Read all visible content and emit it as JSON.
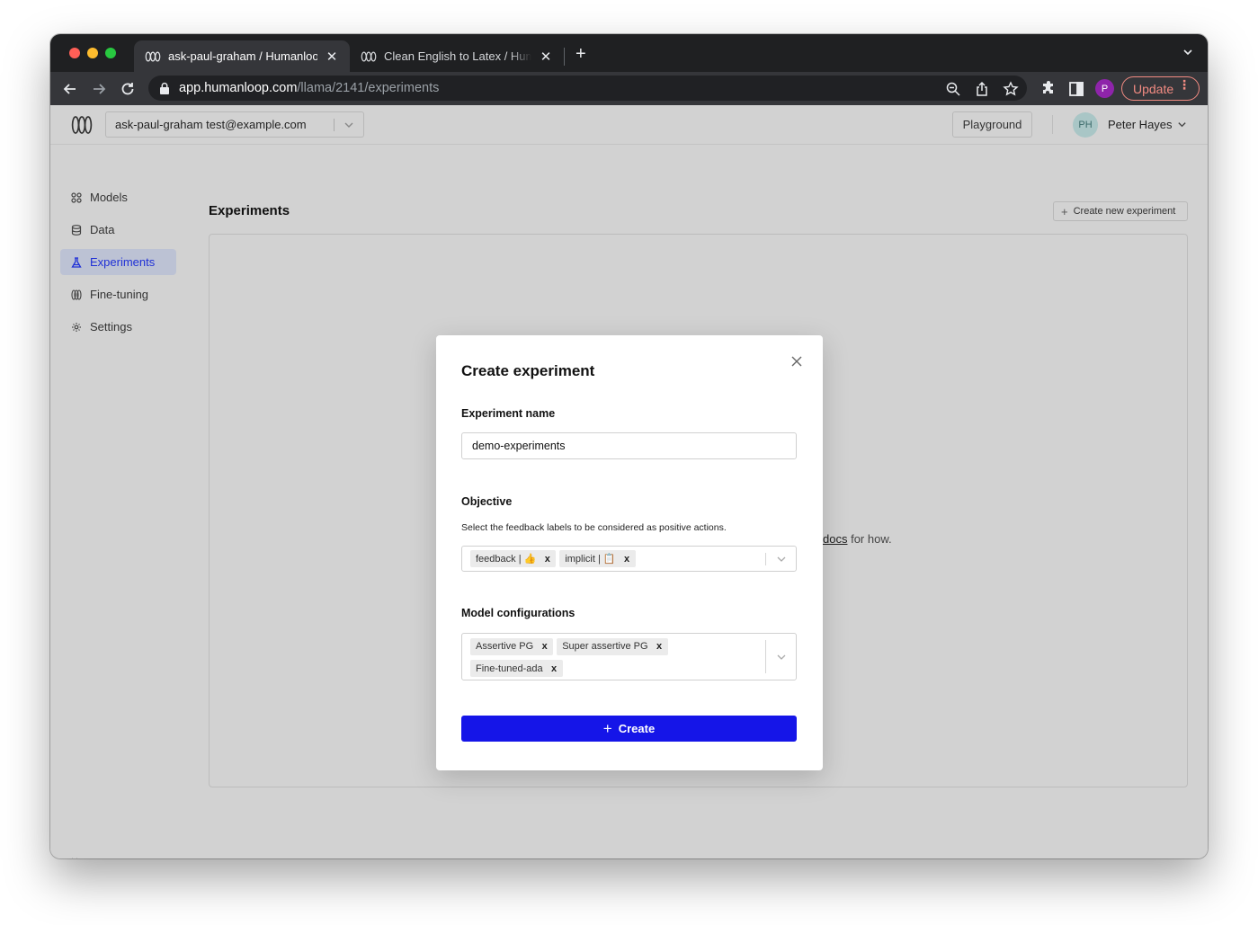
{
  "browser": {
    "tabs": [
      {
        "title": "ask-paul-graham / Humanloop",
        "active": true
      },
      {
        "title": "Clean English to Latex / Humanloop",
        "active": false
      }
    ],
    "new_tab": "+",
    "url_host": "app.humanloop.com",
    "url_path": "/llama/2141/experiments",
    "profile_initial": "P",
    "update_label": "Update"
  },
  "header": {
    "project": "ask-paul-graham test@example.com",
    "playground_label": "Playground",
    "user_initials": "PH",
    "user_name": "Peter Hayes"
  },
  "sidebar": {
    "items": [
      {
        "label": "Models",
        "icon": "grid-icon"
      },
      {
        "label": "Data",
        "icon": "database-icon"
      },
      {
        "label": "Experiments",
        "icon": "flask-icon",
        "active": true
      },
      {
        "label": "Fine-tuning",
        "icon": "humanloop-icon"
      },
      {
        "label": "Settings",
        "icon": "gear-icon"
      }
    ]
  },
  "main": {
    "title": "Experiments",
    "create_button": "Create new experiment",
    "hint_link": "docs",
    "hint_suffix": " for how."
  },
  "modal": {
    "title": "Create experiment",
    "name_label": "Experiment name",
    "name_value": "demo-experiments",
    "objective_label": "Objective",
    "objective_help": "Select the feedback labels to be considered as positive actions.",
    "objective_chips": [
      "feedback | 👍",
      "implicit | 📋"
    ],
    "models_label": "Model configurations",
    "model_chips": [
      "Assertive PG",
      "Super assertive PG",
      "Fine-tuned-ada"
    ],
    "chip_remove": "x",
    "create_label": "Create"
  },
  "colors": {
    "accent": "#1515e8",
    "active_nav_text": "#1f30d6",
    "update": "#f28b82"
  }
}
